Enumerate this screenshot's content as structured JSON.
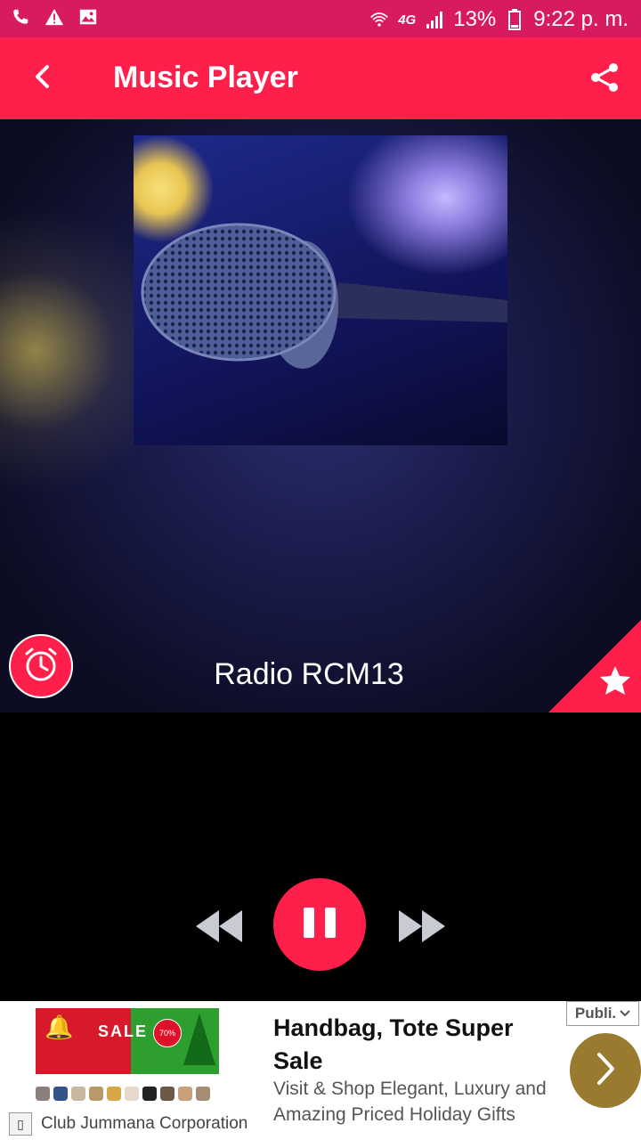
{
  "status_bar": {
    "battery": "13%",
    "time": "9:22 p. m.",
    "network": "4G",
    "icons": [
      "phone-icon",
      "warning-icon",
      "image-icon",
      "wifi-icon",
      "signal-icon",
      "battery-icon"
    ]
  },
  "toolbar": {
    "title": "Music Player",
    "back_icon": "chevron-left-icon",
    "share_icon": "share-icon"
  },
  "player": {
    "station_name": "Radio RCM13",
    "sleep_icon": "alarm-clock-icon",
    "favorite_icon": "star-icon",
    "controls": {
      "prev_icon": "rewind-icon",
      "play_state_icon": "pause-icon",
      "next_icon": "fast-forward-icon"
    }
  },
  "ad": {
    "headline": "Handbag, Tote Super Sale",
    "description": "Visit & Shop Elegant, Luxury and Amazing Priced Holiday Gifts",
    "advertiser": "Club Jummana Corporation",
    "badge": "Publi.",
    "banner_text": "SALE",
    "banner_percent": "70%",
    "cta_icon": "chevron-right-icon"
  },
  "colors": {
    "status_bar": "#d81b60",
    "accent": "#ff1f4b",
    "ad_cta": "#9a7a2e"
  }
}
